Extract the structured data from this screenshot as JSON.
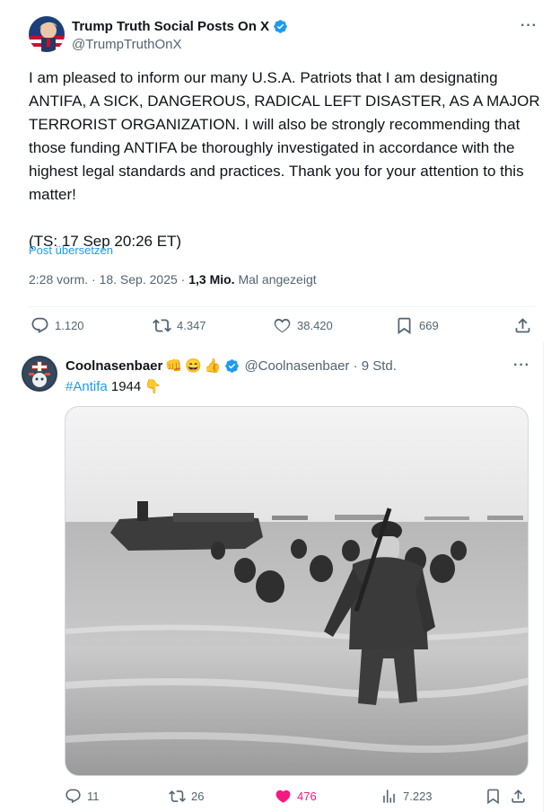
{
  "tweet1": {
    "display_name": "Trump Truth Social Posts On X",
    "handle": "@TrumpTruthOnX",
    "text": "I am pleased to inform our many U.S.A. Patriots that I am designating ANTIFA, A SICK, DANGEROUS, RADICAL LEFT DISASTER, AS A MAJOR TERRORIST ORGANIZATION. I will also be strongly recommending that those funding ANTIFA be thoroughly investigated in accordance with the highest legal standards and practices. Thank you for your attention to this matter!\n\n(TS: 17 Sep 20:26 ET)",
    "translate_label": "Post übersetzen",
    "timestamp": "2:28 vorm. · 18. Sep. 2025 ·",
    "views_count": "1,3 Mio.",
    "views_label": "Mal angezeigt",
    "replies": "1.120",
    "reposts": "4.347",
    "likes": "38.420",
    "bookmarks": "669",
    "more_label": "···"
  },
  "tweet2": {
    "display_name": "Coolnasenbaer",
    "name_emojis": [
      "👊",
      "😄",
      "👍"
    ],
    "handle_time": "@Coolnasenbaer · 9 Std.",
    "hashtag": "#Antifa",
    "text_rest": " 1944",
    "text_emoji": "👇",
    "replies": "11",
    "reposts": "26",
    "likes": "476",
    "views": "7.223",
    "more_label": "···"
  },
  "colors": {
    "verified": "#1d9bf0",
    "link": "#1d9bf0",
    "like_active": "#f91880",
    "secondary_text": "#536471"
  },
  "icons": [
    "verified-badge-icon",
    "more-icon",
    "reply-icon",
    "repost-icon",
    "like-icon",
    "bookmark-icon",
    "share-icon",
    "views-icon"
  ]
}
